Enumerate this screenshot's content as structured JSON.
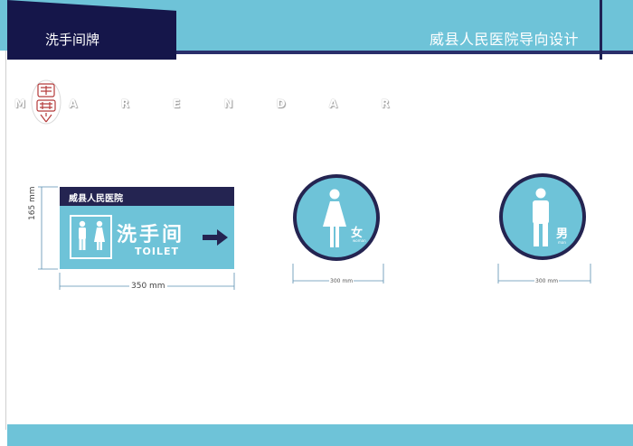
{
  "header": {
    "title": "洗手间牌",
    "project": "威县人民医院导向设计"
  },
  "logo": {
    "wordmark": "M A R E N D A R"
  },
  "rect_sign": {
    "hospital": "威县人民医院",
    "main_text": "洗手间",
    "sub_text": "TOILET",
    "width_label": "350 mm",
    "height_label": "165 mm"
  },
  "female_sign": {
    "char": "女",
    "sub": "woman",
    "width_label": "300 mm"
  },
  "male_sign": {
    "char": "男",
    "sub": "man",
    "width_label": "300 mm"
  },
  "colors": {
    "accent": "#6ec3d8",
    "navy": "#242451"
  }
}
